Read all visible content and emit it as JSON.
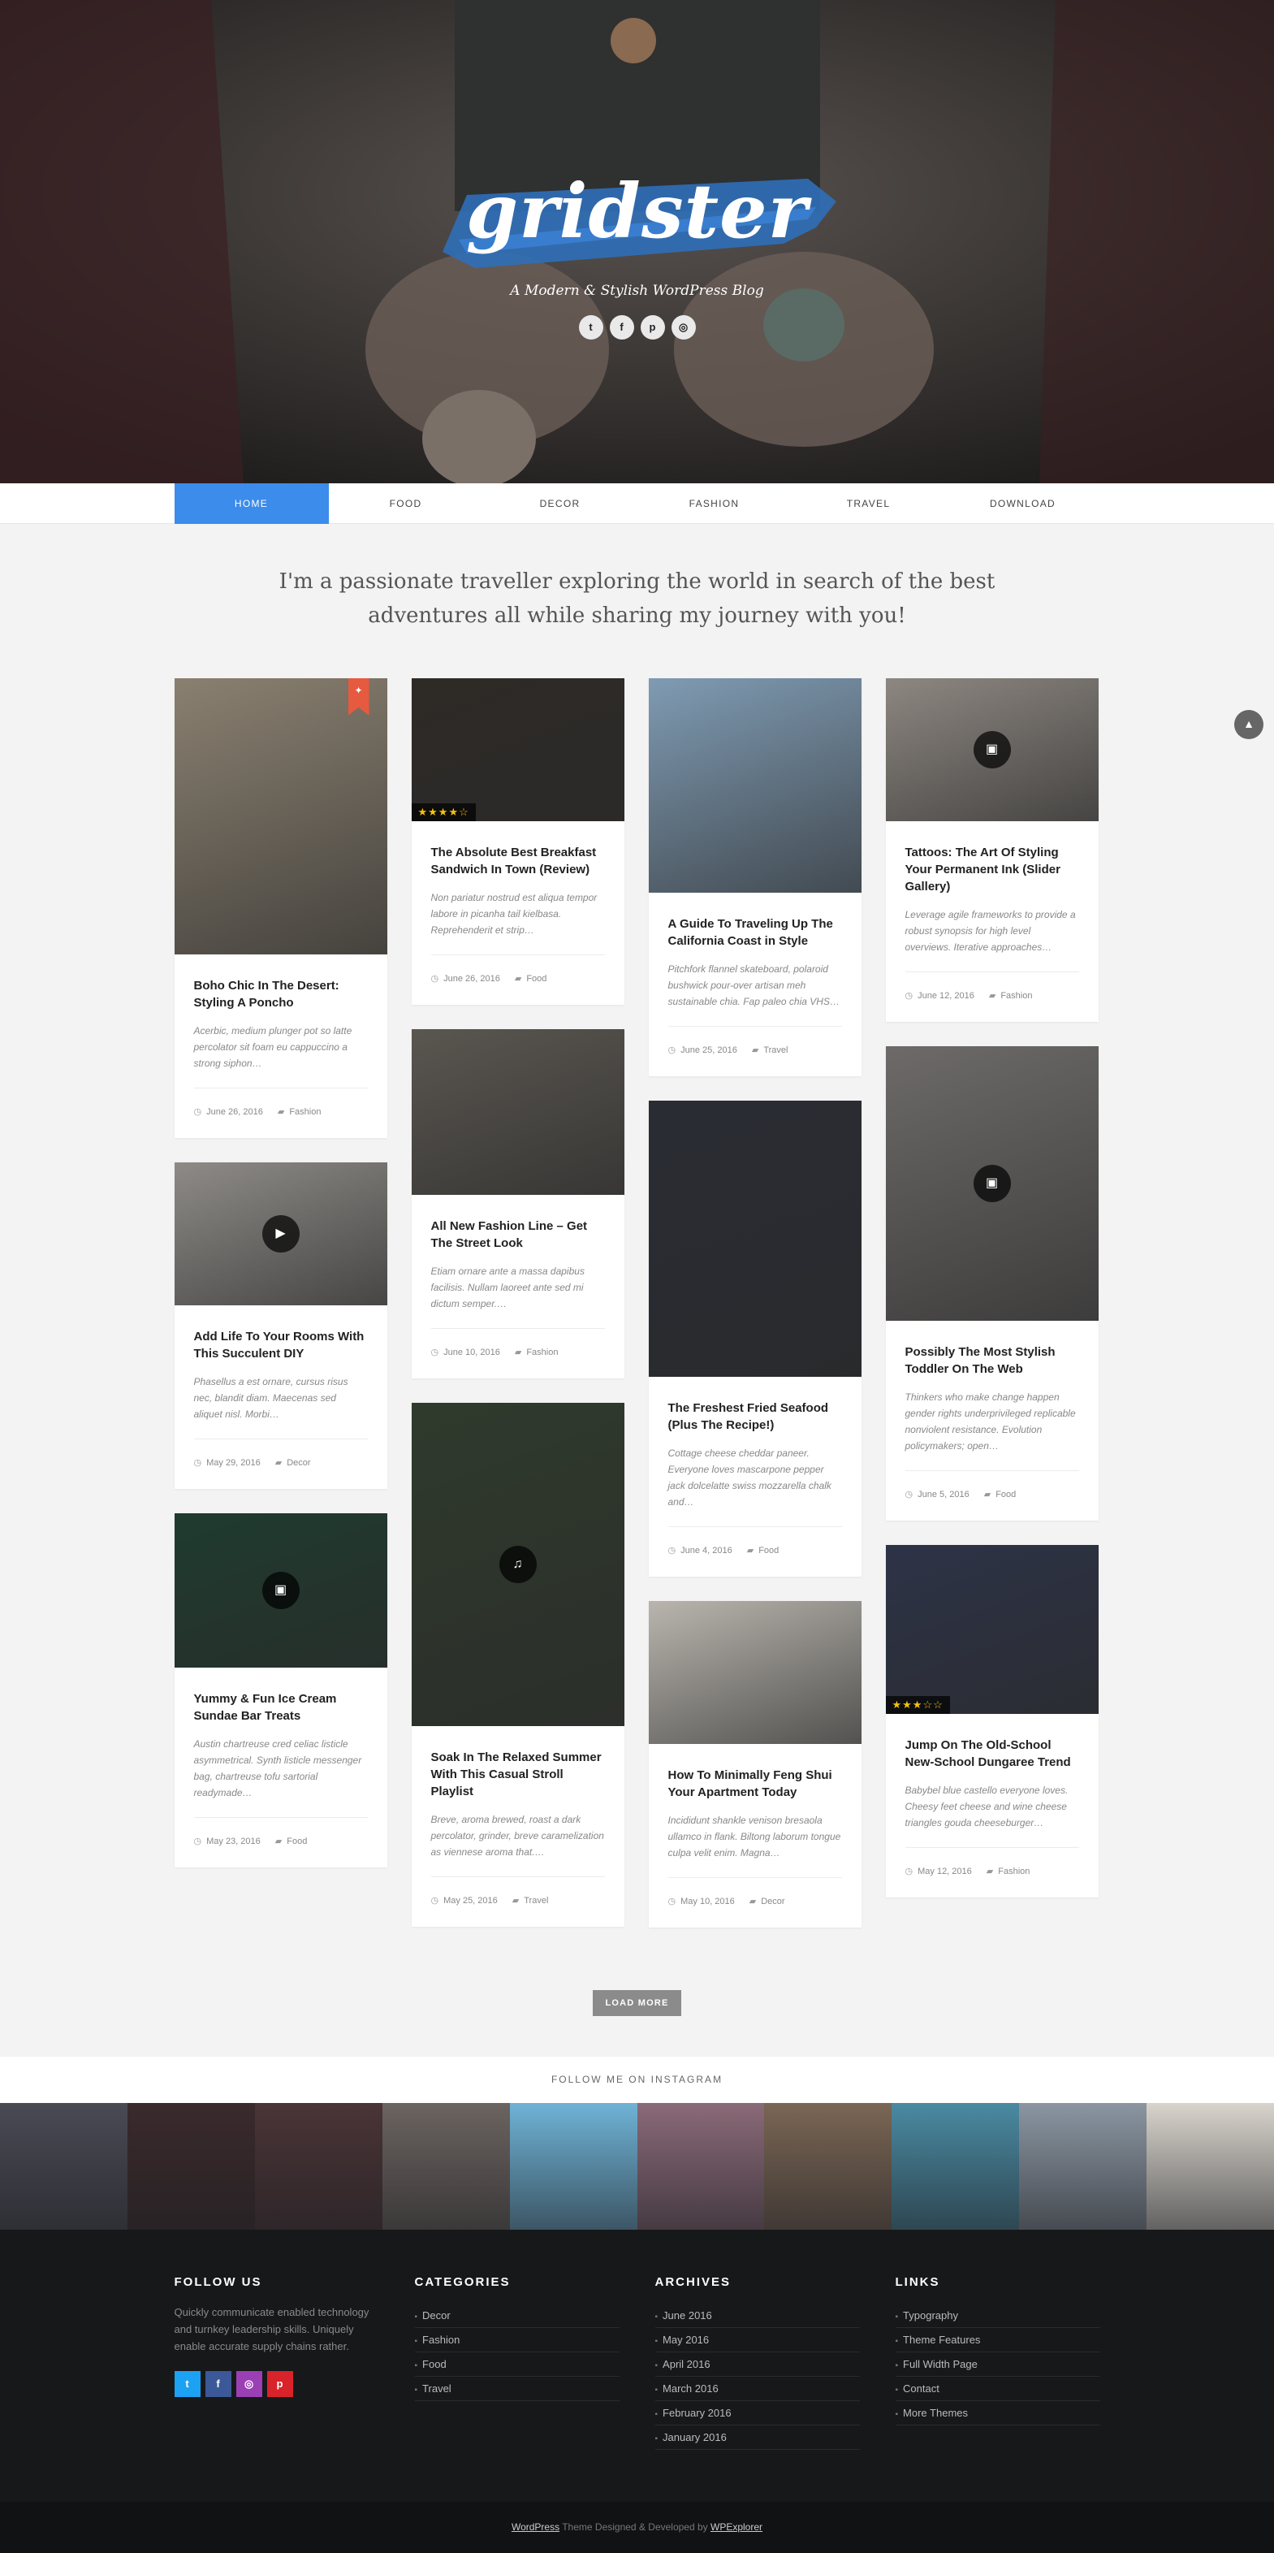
{
  "hero": {
    "logo": "gridster",
    "tagline": "A Modern & Stylish WordPress Blog",
    "social": [
      {
        "icon": "twitter-icon",
        "glyph": "t"
      },
      {
        "icon": "facebook-icon",
        "glyph": "f"
      },
      {
        "icon": "pinterest-icon",
        "glyph": "p"
      },
      {
        "icon": "instagram-icon",
        "glyph": "◎"
      }
    ]
  },
  "nav": {
    "items": [
      "HOME",
      "FOOD",
      "DECOR",
      "FASHION",
      "TRAVEL",
      "DOWNLOAD"
    ],
    "active": 0
  },
  "intro": "I'm a passionate traveller exploring the world in search of the best adventures all while sharing my journey with you!",
  "posts": [
    {
      "col": 0,
      "title": "Boho Chic In The Desert: Styling A Poncho",
      "excerpt": "Acerbic, medium plunger pot so latte percolator sit foam eu cappuccino a strong siphon…",
      "date": "June 26, 2016",
      "category": "Fashion",
      "color": "#8a8070",
      "sticky": true
    },
    {
      "col": 0,
      "title": "Add Life To Your Rooms With This Succulent DIY",
      "excerpt": "Phasellus a est ornare, cursus risus nec, blandit diam. Maecenas sed aliquet nisl. Morbi…",
      "date": "May 29, 2016",
      "category": "Decor",
      "color": "#8e8b87",
      "badge": "▶"
    },
    {
      "col": 0,
      "title": "Yummy & Fun Ice Cream Sundae Bar Treats",
      "excerpt": "Austin chartreuse cred celiac listicle asymmetrical. Synth listicle messenger bag, chartreuse tofu sartorial readymade…",
      "date": "May 23, 2016",
      "category": "Food",
      "color": "#1f3b2f",
      "badge": "▣"
    },
    {
      "col": 1,
      "title": "The Absolute Best Breakfast Sandwich In Town (Review)",
      "excerpt": "Non pariatur nostrud est aliqua tempor labore in picanha tail kielbasa. Reprehenderit et strip…",
      "date": "June 26, 2016",
      "category": "Food",
      "color": "#2e2a26",
      "stars": "★★★★☆"
    },
    {
      "col": 1,
      "title": "All New Fashion Line – Get The Street Look",
      "excerpt": "Etiam ornare ante a massa dapibus facilisis. Nullam laoreet ante sed mi dictum semper.…",
      "date": "June 10, 2016",
      "category": "Fashion",
      "color": "#5a5650"
    },
    {
      "col": 1,
      "title": "Soak In The Relaxed Summer With This Casual Stroll Playlist",
      "excerpt": "Breve, aroma brewed, roast a dark percolator, grinder, breve caramelization as viennese aroma that.…",
      "date": "May 25, 2016",
      "category": "Travel",
      "color": "#2f3a2c",
      "badge": "♫"
    },
    {
      "col": 2,
      "title": "A Guide To Traveling Up The California Coast in Style",
      "excerpt": "Pitchfork flannel skateboard, polaroid bushwick pour-over artisan meh sustainable chia. Fap paleo chia VHS…",
      "date": "June 25, 2016",
      "category": "Travel",
      "color": "#7f9bb3"
    },
    {
      "col": 2,
      "title": "The Freshest Fried Seafood (Plus The Recipe!)",
      "excerpt": "Cottage cheese cheddar paneer. Everyone loves mascarpone pepper jack dolcelatte swiss mozzarella chalk and…",
      "date": "June 4, 2016",
      "category": "Food",
      "color": "#2a2c34"
    },
    {
      "col": 2,
      "title": "How To Minimally Feng Shui Your Apartment Today",
      "excerpt": "Incididunt shankle venison bresaola ullamco in flank. Biltong laborum tongue culpa velit enim. Magna…",
      "date": "May 10, 2016",
      "category": "Decor",
      "color": "#b9b5ae"
    },
    {
      "col": 3,
      "title": "Tattoos: The Art Of Styling Your Permanent Ink (Slider Gallery)",
      "excerpt": "Leverage agile frameworks to provide a robust synopsis for high level overviews. Iterative approaches…",
      "date": "June 12, 2016",
      "category": "Fashion",
      "color": "#8d8781",
      "badge": "▣"
    },
    {
      "col": 3,
      "title": "Possibly The Most Stylish Toddler On The Web",
      "excerpt": "Thinkers who make change happen gender rights underprivileged replicable nonviolent resistance. Evolution policymakers; open…",
      "date": "June 5, 2016",
      "category": "Food",
      "color": "#6d6a69",
      "badge": "▣"
    },
    {
      "col": 3,
      "title": "Jump On The Old-School New-School Dungaree Trend",
      "excerpt": "Babybel blue castello everyone loves. Cheesy feet cheese and wine cheese triangles gouda cheeseburger…",
      "date": "May 12, 2016",
      "category": "Fashion",
      "color": "#2d3347",
      "stars": "★★★☆☆"
    }
  ],
  "load_more": "LOAD MORE",
  "instagram": {
    "title": "FOLLOW ME ON INSTAGRAM",
    "tiles": [
      "#4a4a55",
      "#3a2a2c",
      "#4a3436",
      "#6b6460",
      "#6fb3d6",
      "#8a6a78",
      "#7a6654",
      "#4a8aa2",
      "#8b96a2",
      "#d8d4cc"
    ]
  },
  "footer": {
    "follow": {
      "title": "FOLLOW US",
      "text": "Quickly communicate enabled technology and turnkey leadership skills. Uniquely enable accurate supply chains rather.",
      "social": [
        {
          "icon": "twitter-icon",
          "glyph": "t",
          "color": "#1da1f2"
        },
        {
          "icon": "facebook-icon",
          "glyph": "f",
          "color": "#3b5998"
        },
        {
          "icon": "instagram-icon",
          "glyph": "◎",
          "color": "#9b3fb4"
        },
        {
          "icon": "pinterest-icon",
          "glyph": "p",
          "color": "#d8232a"
        }
      ]
    },
    "categories": {
      "title": "CATEGORIES",
      "items": [
        "Decor",
        "Fashion",
        "Food",
        "Travel"
      ]
    },
    "archives": {
      "title": "ARCHIVES",
      "items": [
        "June 2016",
        "May 2016",
        "April 2016",
        "March 2016",
        "February 2016",
        "January 2016"
      ]
    },
    "links": {
      "title": "LINKS",
      "items": [
        "Typography",
        "Theme Features",
        "Full Width Page",
        "Contact",
        "More Themes"
      ]
    }
  },
  "copyright": {
    "wp": "WordPress",
    "middle": " Theme Designed & Developed by ",
    "author": "WPExplorer"
  },
  "side_button": "▲"
}
